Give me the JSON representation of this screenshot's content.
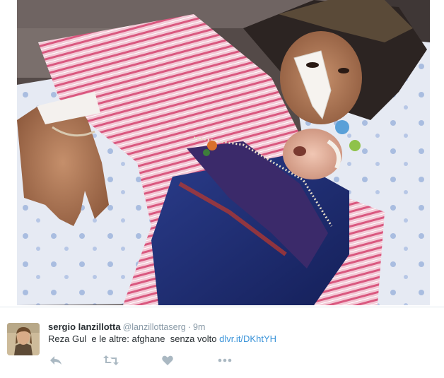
{
  "photo": {
    "alt_icon": "tweet-photo"
  },
  "tweet": {
    "author": {
      "fullname": "sergio lanzillotta",
      "screenname": "@lanzillottaserg",
      "separator": "·",
      "time": "9m"
    },
    "text_plain": "Reza Gul  e le altre: afghane  senza volto ",
    "link_text": "dlvr.it/DKhtYH",
    "actions": [
      {
        "name": "reply",
        "icon": "reply-icon"
      },
      {
        "name": "retweet",
        "icon": "retweet-icon"
      },
      {
        "name": "like",
        "icon": "heart-icon"
      },
      {
        "name": "more",
        "icon": "more-icon"
      }
    ],
    "colors": {
      "link": "#3b94d9",
      "secondary_text": "#8899a6",
      "icon": "#aab8c2"
    }
  }
}
